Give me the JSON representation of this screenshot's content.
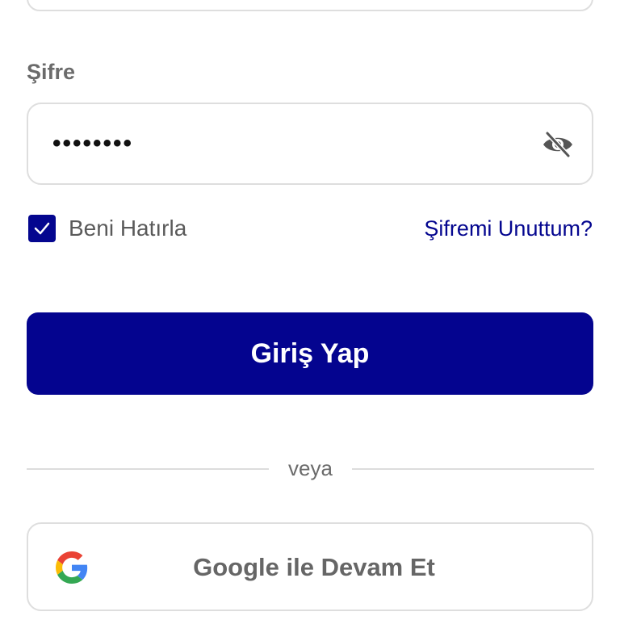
{
  "form": {
    "password_label": "Şifre",
    "password_value": "••••••••",
    "remember_label": "Beni Hatırla",
    "remember_checked": true,
    "forgot_label": "Şifremi Unuttum?",
    "login_label": "Giriş Yap",
    "divider_text": "veya",
    "google_label": "Google ile Devam Et"
  },
  "icons": {
    "password_toggle": "eye-off-icon",
    "checkbox": "check-icon",
    "google": "google-logo-icon"
  },
  "colors": {
    "primary": "#04048f",
    "link": "#04068f",
    "border": "#dedede",
    "muted_text": "#6b6b6b"
  }
}
